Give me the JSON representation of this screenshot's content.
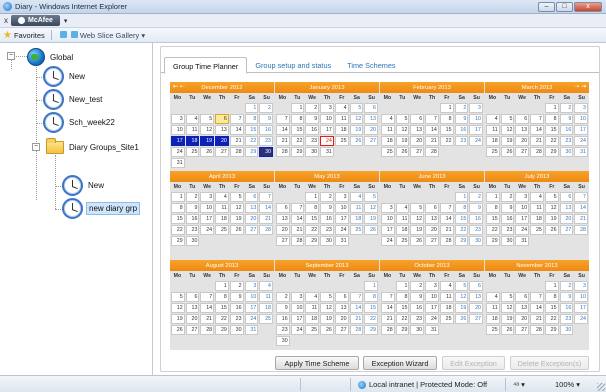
{
  "window": {
    "title": "Diary - Windows Internet Explorer",
    "min": "–",
    "max": "□",
    "close": "x"
  },
  "addon": {
    "close": "x",
    "label": "McAfee",
    "dropdown": "▾"
  },
  "favorites": {
    "label": "Favorites",
    "web_slice": "Web Slice Gallery ▾"
  },
  "tree": {
    "root": "Global",
    "items": [
      "New",
      "New_test",
      "Sch_week22"
    ],
    "group": "Diary Groups_Site1",
    "group_items": [
      "New",
      "new diary grp"
    ]
  },
  "tabs": [
    "Group Time Planner",
    "Group setup and status",
    "Time Schemes"
  ],
  "dow": [
    "Mo",
    "Tu",
    "We",
    "Th",
    "Fr",
    "Sa",
    "Su"
  ],
  "months": [
    {
      "name": "December 2012",
      "offset": 5,
      "days": 31,
      "nav": "left",
      "nav_glyphs": "⇤ ⇠"
    },
    {
      "name": "January 2013",
      "offset": 1,
      "days": 31
    },
    {
      "name": "February 2013",
      "offset": 4,
      "days": 28
    },
    {
      "name": "March 2013",
      "offset": 4,
      "days": 31,
      "nav": "right",
      "nav_glyphs": "⇢ ⇥"
    },
    {
      "name": "April 2013",
      "offset": 0,
      "days": 30
    },
    {
      "name": "May 2013",
      "offset": 2,
      "days": 31
    },
    {
      "name": "June 2013",
      "offset": 5,
      "days": 30
    },
    {
      "name": "July 2013",
      "offset": 0,
      "days": 31
    },
    {
      "name": "August 2013",
      "offset": 3,
      "days": 31
    },
    {
      "name": "September 2013",
      "offset": 6,
      "days": 30
    },
    {
      "name": "October 2013",
      "offset": 1,
      "days": 31
    },
    {
      "name": "November 2013",
      "offset": 4,
      "days": 30
    }
  ],
  "highlights": {
    "December 2012": {
      "today": [
        6
      ],
      "selected": [
        17,
        18,
        19,
        20
      ],
      "selected_dark": [
        30
      ]
    },
    "January 2013": {
      "marked": [
        24
      ]
    }
  },
  "buttons": {
    "apply": "Apply Time Scheme",
    "exception_wizard": "Exception Wizard",
    "edit_exception": "Edit Exception",
    "delete_exception": "Delete Exception(s)"
  },
  "status": {
    "zone": "Local intranet | Protected Mode: Off",
    "security": "⁴ᵃ ▾",
    "zoom": "100% ▾"
  }
}
